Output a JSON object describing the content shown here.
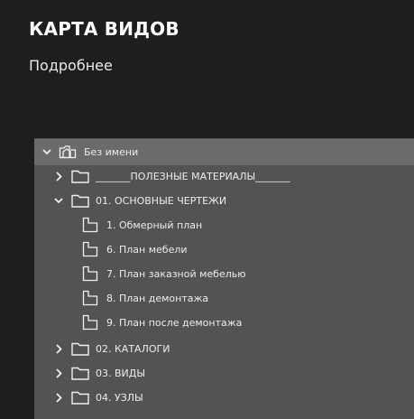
{
  "card": {
    "title": "КАРТА ВИДОВ",
    "link": "Подробнее"
  },
  "tree": {
    "root": {
      "label": "Без имени",
      "icon": "document-group-icon",
      "expanded": true
    },
    "items": [
      {
        "label": "_______ПОЛЕЗНЫЕ МАТЕРИАЛЫ_______",
        "type": "folder",
        "expanded": false
      },
      {
        "label": "01. ОСНОВНЫЕ ЧЕРТЕЖИ",
        "type": "folder",
        "expanded": true,
        "children": [
          {
            "label": "1. Обмерный план",
            "type": "view"
          },
          {
            "label": "6.  План мебели",
            "type": "view"
          },
          {
            "label": "7.  План заказной мебелью",
            "type": "view"
          },
          {
            "label": "8.  План демонтажа",
            "type": "view"
          },
          {
            "label": "9.  План после демонтажа",
            "type": "view"
          }
        ]
      },
      {
        "label": "02. КАТАЛОГИ",
        "type": "folder",
        "expanded": false
      },
      {
        "label": "03. ВИДЫ",
        "type": "folder",
        "expanded": false
      },
      {
        "label": "04. УЗЛЫ",
        "type": "folder",
        "expanded": false
      }
    ]
  },
  "colors": {
    "background": "#1e1e1e",
    "panel": "#535353",
    "root_row": "#6b6b6b",
    "text": "#ececec"
  }
}
